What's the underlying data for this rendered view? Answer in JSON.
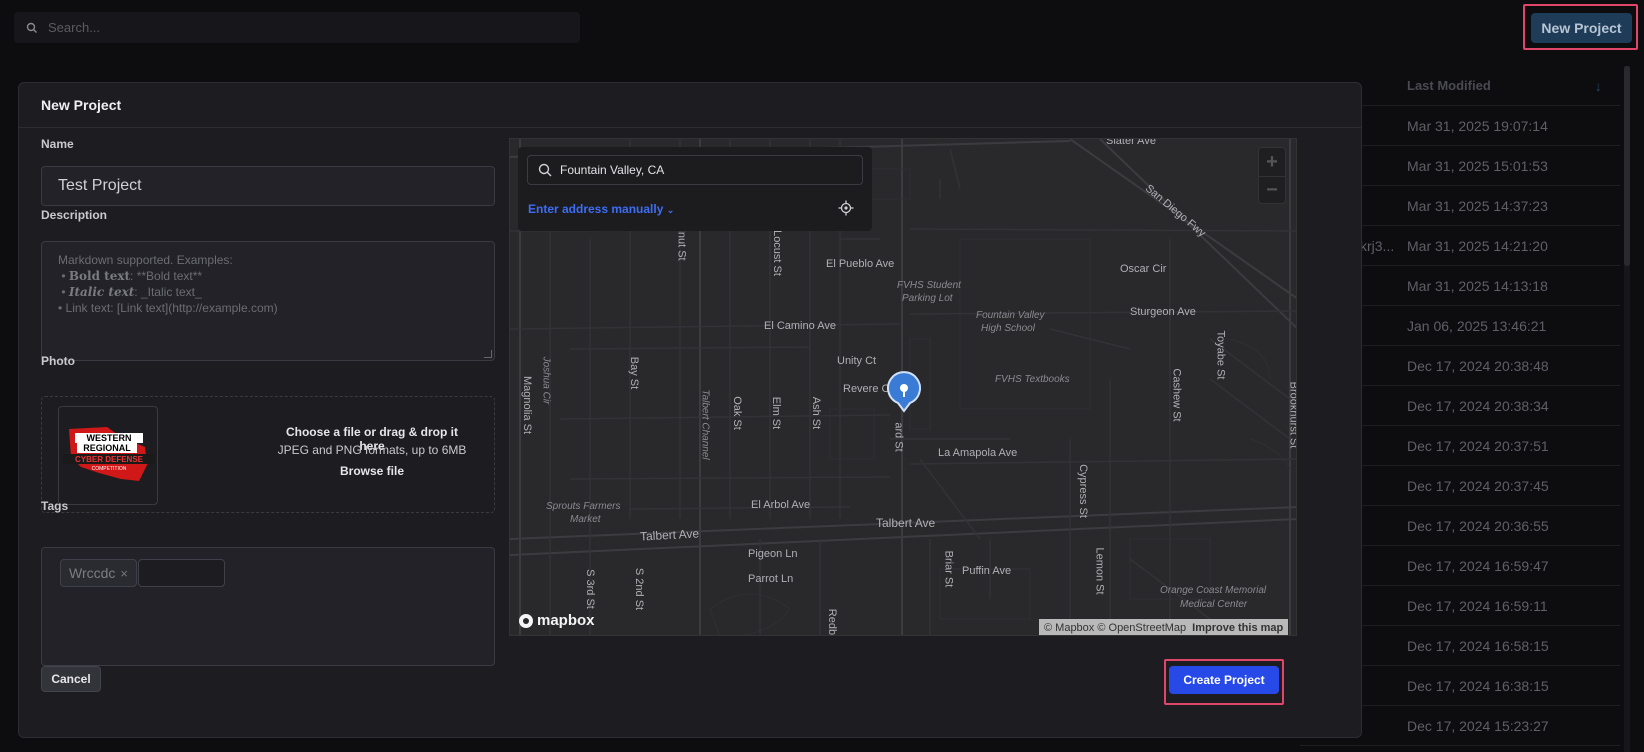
{
  "search": {
    "placeholder": "Search..."
  },
  "header": {
    "new_project_label": "New Project"
  },
  "table": {
    "last_modified_header": "Last Modified",
    "fragment": "krj3...",
    "dates": [
      "Mar 31, 2025 19:07:14",
      "Mar 31, 2025 15:01:53",
      "Mar 31, 2025 14:37:23",
      "Mar 31, 2025 14:21:20",
      "Mar 31, 2025 14:13:18",
      "Jan 06, 2025 13:46:21",
      "Dec 17, 2024 20:38:48",
      "Dec 17, 2024 20:38:34",
      "Dec 17, 2024 20:37:51",
      "Dec 17, 2024 20:37:45",
      "Dec 17, 2024 20:36:55",
      "Dec 17, 2024 16:59:47",
      "Dec 17, 2024 16:59:11",
      "Dec 17, 2024 16:58:15",
      "Dec 17, 2024 16:38:15",
      "Dec 17, 2024 15:23:27"
    ]
  },
  "modal": {
    "title": "New Project",
    "name_label": "Name",
    "name_value": "Test Project",
    "description_label": "Description",
    "description_placeholder": {
      "line1": "Markdown supported. Examples:",
      "bold_label": "Bold text",
      "bold_example": ": **Bold text**",
      "italic_label": "Italic text",
      "italic_example": ": _Italic text_",
      "link": "• Link text: [Link text](http://example.com)"
    },
    "photo_label": "Photo",
    "photo_logo_text": "WESTERN REGIONAL CYBER DEFENSE COMPETITION",
    "drop_title": "Choose a file or drag & drop it here",
    "drop_formats": "JPEG and PNG formats, up to 6MB",
    "browse_label": "Browse file",
    "tags_label": "Tags",
    "tags": [
      "Wrccdc"
    ],
    "cancel_label": "Cancel",
    "create_label": "Create Project"
  },
  "map": {
    "search_value": "Fountain Valley, CA",
    "manual_label": "Enter address manually",
    "zoom_in": "+",
    "zoom_out": "−",
    "logo_text": "mapbox",
    "attribution": "© Mapbox © OpenStreetMap",
    "improve_label": "Improve this map",
    "labels": {
      "slater": "Slater Ave",
      "san_diego_fwy": "San Diego Fwy",
      "el_pueblo": "El Pueblo Ave",
      "fvhs_parking": "FVHS Student",
      "fvhs_parking2": "Parking Lot",
      "oscar": "Oscar Cir",
      "el_camino": "El Camino Ave",
      "fv_high": "Fountain Valley",
      "fv_high2": "High School",
      "sturgeon": "Sturgeon Ave",
      "unity": "Unity Ct",
      "revere": "Revere Ct",
      "fvhs_textbooks": "FVHS Textbooks",
      "la_amapola": "La Amapola Ave",
      "el_arbol": "El Arbol Ave",
      "sprouts": "Sprouts Farmers",
      "sprouts2": "Market",
      "talbert1": "Talbert Ave",
      "talbert2": "Talbert Ave",
      "pigeon": "Pigeon Ln",
      "parrot": "Parrot Ln",
      "puffin": "Puffin Ave",
      "ocmmc": "Orange Coast Memorial",
      "ocmmc2": "Medical Center",
      "magnolia": "Magnolia St",
      "brookhurst": "Brookhurst St",
      "bay": "Bay St",
      "oak": "Oak St",
      "elm": "Elm St",
      "ash": "Ash St",
      "locust": "Locust St",
      "walnut": "lnut St",
      "joshua": "Joshua Cir",
      "talbert_channel": "Talbert Channel",
      "ward": "ard St",
      "cashew": "Cashew St",
      "toyabe": "Toyabe St",
      "cypress": "Cypress St",
      "lemon": "Lemon St",
      "briar": "Briar St",
      "s3rd": "S 3rd St",
      "s2nd": "S 2nd St",
      "redbud": "Redbu"
    }
  }
}
